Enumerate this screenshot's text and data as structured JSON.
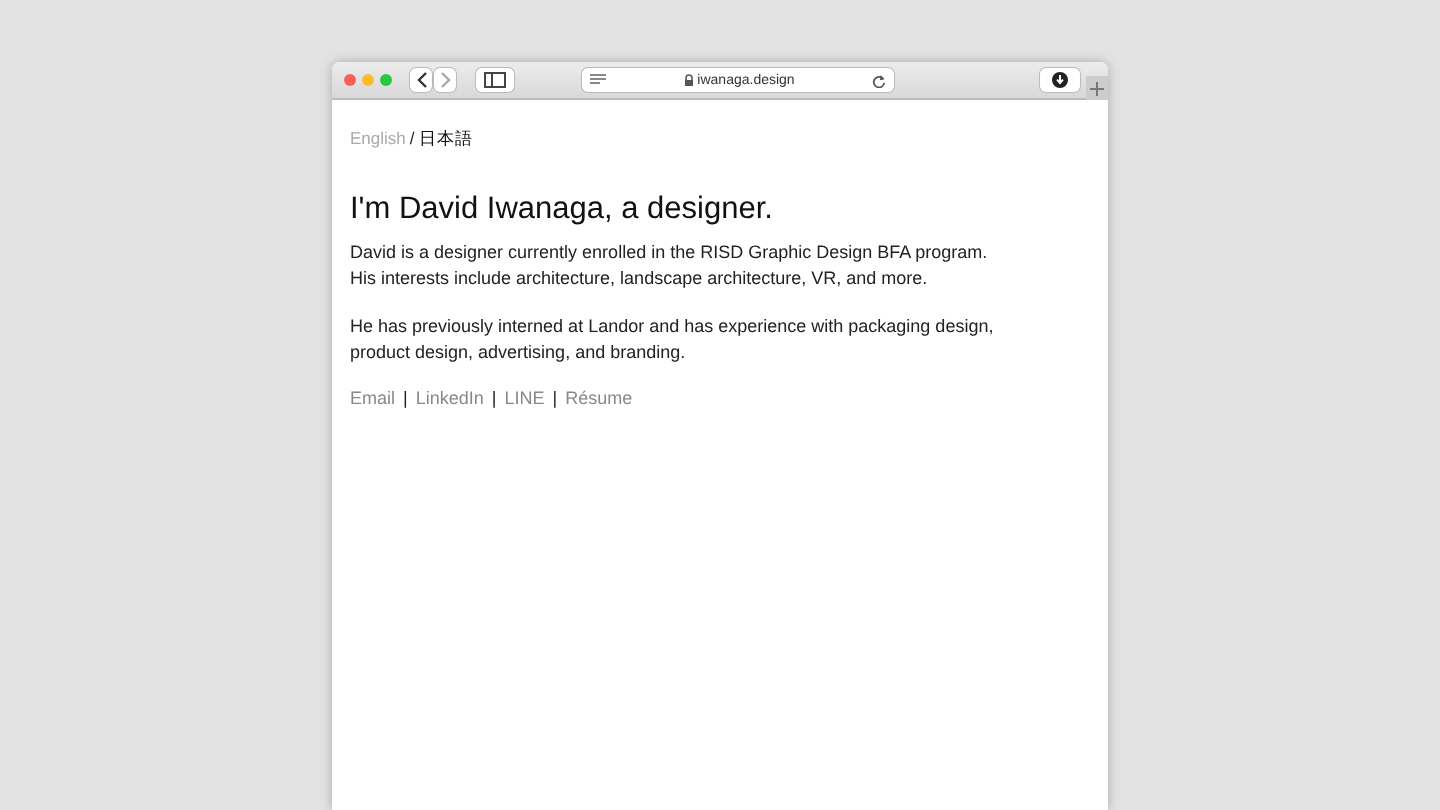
{
  "browser": {
    "address": "iwanaga.design"
  },
  "languages": [
    {
      "label": "English",
      "selected": true,
      "kind": "link"
    },
    {
      "label": "/",
      "kind": "separator"
    },
    {
      "label": "日本語",
      "selected": false,
      "kind": "link"
    }
  ],
  "heading": "I'm David Iwanaga, a designer.",
  "paragraphs": [
    "David is a designer currently enrolled in the RISD Graphic Design BFA program.\nHis interests include architecture, landscape architecture, VR, and more.",
    "He has previously interned at Landor and has experience with packaging design,\nproduct design, advertising, and branding."
  ],
  "links": [
    {
      "label": "Email",
      "kind": "link"
    },
    {
      "label": "|",
      "kind": "separator"
    },
    {
      "label": "LinkedIn",
      "kind": "link"
    },
    {
      "label": "|",
      "kind": "separator"
    },
    {
      "label": "LINE",
      "kind": "link"
    },
    {
      "label": "|",
      "kind": "separator"
    },
    {
      "label": "Résume",
      "kind": "link"
    }
  ]
}
